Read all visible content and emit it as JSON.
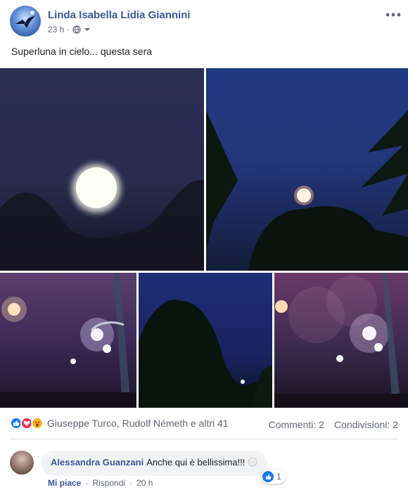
{
  "post": {
    "author": "Linda Isabella Lidia Giannini",
    "time": "23 h",
    "more_icon": "more-dots-icon",
    "privacy_icon": "globe-icon",
    "text": "Superluna in cielo... questa sera"
  },
  "photos": [
    {
      "subject": "full-moon-closeup"
    },
    {
      "subject": "moon-over-palms"
    },
    {
      "subject": "street-lamps"
    },
    {
      "subject": "trees-night-sky"
    },
    {
      "subject": "street-lamps-lens-flare"
    }
  ],
  "reactions": {
    "icons": [
      "like-icon",
      "love-icon",
      "wow-icon"
    ],
    "names": "Giuseppe Turco, Rudolf Németh e altri 41",
    "comments": "Commenti: 2",
    "shares": "Condivisioni: 2"
  },
  "comment": {
    "author": "Alessandra Guanzani",
    "text": "Anche qui è bellissima!!!",
    "reaction_count": "1",
    "like_label": "Mi piace",
    "reply_label": "Rispondi",
    "time": "20 h",
    "separator": "·"
  },
  "colors": {
    "link": "#385898",
    "like_blue": "#1877f2",
    "love_red": "#f0284a",
    "wow_yellow": "#f7b125"
  }
}
